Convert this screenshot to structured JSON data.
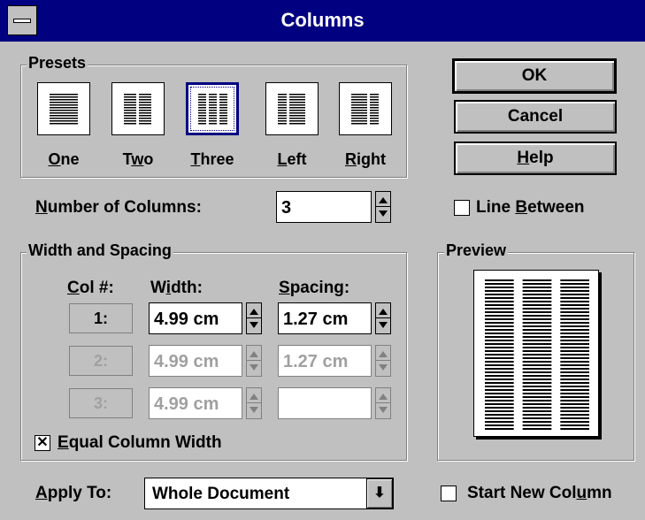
{
  "window": {
    "title": "Columns"
  },
  "presets": {
    "legend": "Presets",
    "items": [
      {
        "pre": "",
        "u": "O",
        "post": "ne",
        "cols": 1,
        "selected": false
      },
      {
        "pre": "T",
        "u": "w",
        "post": "o",
        "cols": 2,
        "selected": false
      },
      {
        "pre": "",
        "u": "T",
        "post": "hree",
        "cols": 3,
        "selected": true
      },
      {
        "pre": "",
        "u": "L",
        "post": "eft",
        "cols": 2,
        "selected": false
      },
      {
        "pre": "",
        "u": "R",
        "post": "ight",
        "cols": 2,
        "selected": false
      }
    ]
  },
  "buttons": {
    "ok": "OK",
    "cancel": "Cancel",
    "help": {
      "u": "H",
      "post": "elp"
    }
  },
  "number_of_columns": {
    "u": "N",
    "post": "umber of Columns:",
    "value": "3"
  },
  "line_between": {
    "pre": "Line ",
    "u": "B",
    "post": "etween",
    "checked": false
  },
  "width_spacing": {
    "legend": "Width and Spacing",
    "col_header": {
      "u": "C",
      "post": "ol #:"
    },
    "width_header": {
      "pre": "W",
      "u": "i",
      "post": "dth:"
    },
    "spacing_header": {
      "u": "S",
      "post": "pacing:"
    },
    "rows": [
      {
        "col": "1:",
        "width": "4.99 cm",
        "spacing": "1.27 cm",
        "enabled": true
      },
      {
        "col": "2:",
        "width": "4.99 cm",
        "spacing": "1.27 cm",
        "enabled": false
      },
      {
        "col": "3:",
        "width": "4.99 cm",
        "spacing": "",
        "enabled": false
      }
    ]
  },
  "equal_width": {
    "u": "E",
    "post": "qual Column Width",
    "checked": true
  },
  "preview": {
    "legend": "Preview"
  },
  "apply_to": {
    "u": "A",
    "post": "pply To:",
    "value": "Whole Document"
  },
  "start_new_column": {
    "pre": "Start New Col",
    "u": "u",
    "post": "mn",
    "checked": false
  }
}
